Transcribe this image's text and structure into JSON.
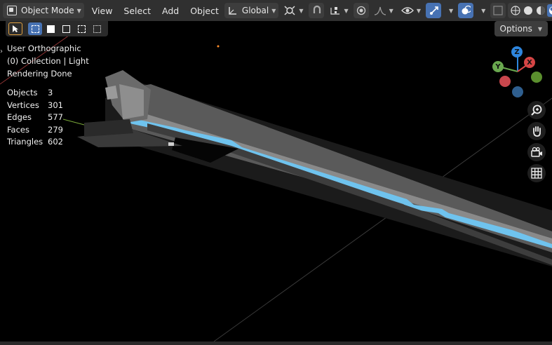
{
  "header": {
    "mode_label": "Object Mode",
    "menus": [
      "View",
      "Select",
      "Add",
      "Object"
    ],
    "transform_orientation": "Global"
  },
  "toolbar": {
    "options_label": "Options"
  },
  "overlay": {
    "view_name": "User Orthographic",
    "collection": "(0) Collection | Light",
    "status": "Rendering Done"
  },
  "stats": [
    {
      "label": "Objects",
      "value": "3"
    },
    {
      "label": "Vertices",
      "value": "301"
    },
    {
      "label": "Edges",
      "value": "577"
    },
    {
      "label": "Faces",
      "value": "279"
    },
    {
      "label": "Triangles",
      "value": "602"
    }
  ],
  "gizmo": {
    "z": "Z",
    "y": "Y",
    "x": "X",
    "colors": {
      "z": "#2e86de",
      "y": "#6aa84f",
      "x": "#d64545",
      "neg_x": "#c9474d",
      "neg_y": "#5b8f2e",
      "neg_z": "#2f5f8f"
    }
  },
  "colors": {
    "accent": "#4772b3",
    "glow": "#5fb6ea",
    "header_bg": "#303030"
  },
  "icons": [
    "object-mode-icon",
    "orientation-icon",
    "pivot-icon",
    "snap-icon",
    "proportional-icon",
    "visibility-icon",
    "gizmo-icon",
    "overlay-icon",
    "xray-icon",
    "shading-wire-icon",
    "shading-solid-icon",
    "shading-material-icon",
    "shading-rendered-icon",
    "zoom-icon",
    "hand-icon",
    "camera-icon",
    "grid-icon"
  ]
}
